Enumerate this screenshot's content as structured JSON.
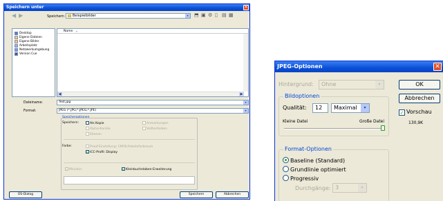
{
  "save_dialog": {
    "title": "Speichern unter",
    "save_in_label": "Speichern in:",
    "save_in_value": "Beispielbilder",
    "places": [
      "Desktop",
      "Eigene Dateien",
      "Eigene Bilder",
      "Arbeitsplatz",
      "Netzwerkumgebung",
      "Version Cue"
    ],
    "column_name": "Name",
    "filename_label": "Dateiname:",
    "filename_value": "Test.jpg",
    "format_label": "Format:",
    "format_value": "JPEG (*.JPG;*.JPEG;*.JPE)",
    "options_title": "Speicheroptionen",
    "speichern_label": "Speichern:",
    "opt_als_kopie": "Als Kopie",
    "opt_anmerkungen": "Anmerkungen",
    "opt_alpha": "Alpha-Kanäle",
    "opt_volltonfarben": "Volltonfarben",
    "opt_ebenen": "Ebenen",
    "farbe_label": "Farbe:",
    "opt_proof": "Proof-Einstellung: CMYK-Arbeitsfarbraum",
    "opt_icc": "ICC-Profil: Display",
    "opt_miniatur": "Miniatur",
    "opt_kleinbuchstaben": "Kleinbuchstaben-Erweiterung",
    "os_dialog_button": "OS-Dialog",
    "save_button": "Speichern",
    "cancel_button": "Abbrechen",
    "icc_checked": "☑",
    "klein_checked": "☑",
    "miniatur_checked": "☑"
  },
  "jpeg_dialog": {
    "title": "JPEG-Optionen",
    "hintergrund_label": "Hintergrund:",
    "hintergrund_value": "Ohne",
    "bildoptionen_title": "Bildoptionen",
    "qualitaet_label": "Qualität:",
    "qualitaet_value": "12",
    "qualitaet_preset": "Maximal",
    "kleine_datei": "Kleine Datei",
    "grosse_datei": "Große Datei",
    "quality_slider_level": 1.0,
    "format_title": "Format-Optionen",
    "baseline": "Baseline (Standard)",
    "grundlinie": "Grundlinie optimiert",
    "progressiv": "Progressiv",
    "durchgaenge_label": "Durchgänge:",
    "durchgaenge_value": "3",
    "ok_button": "OK",
    "cancel_button": "Abbrechen",
    "vorschau_label": "Vorschau",
    "vorschau_check": "✓",
    "file_size": "130,9K"
  },
  "colors": {
    "title_bar": "#0a4fd6",
    "dialog_bg": "#ece9d8",
    "group_title": "#0046d5",
    "check_green": "#21a121"
  },
  "icons": {
    "close": "✕",
    "dropdown": "▾",
    "back": "◀",
    "forward": "▶",
    "sort": "▲"
  }
}
